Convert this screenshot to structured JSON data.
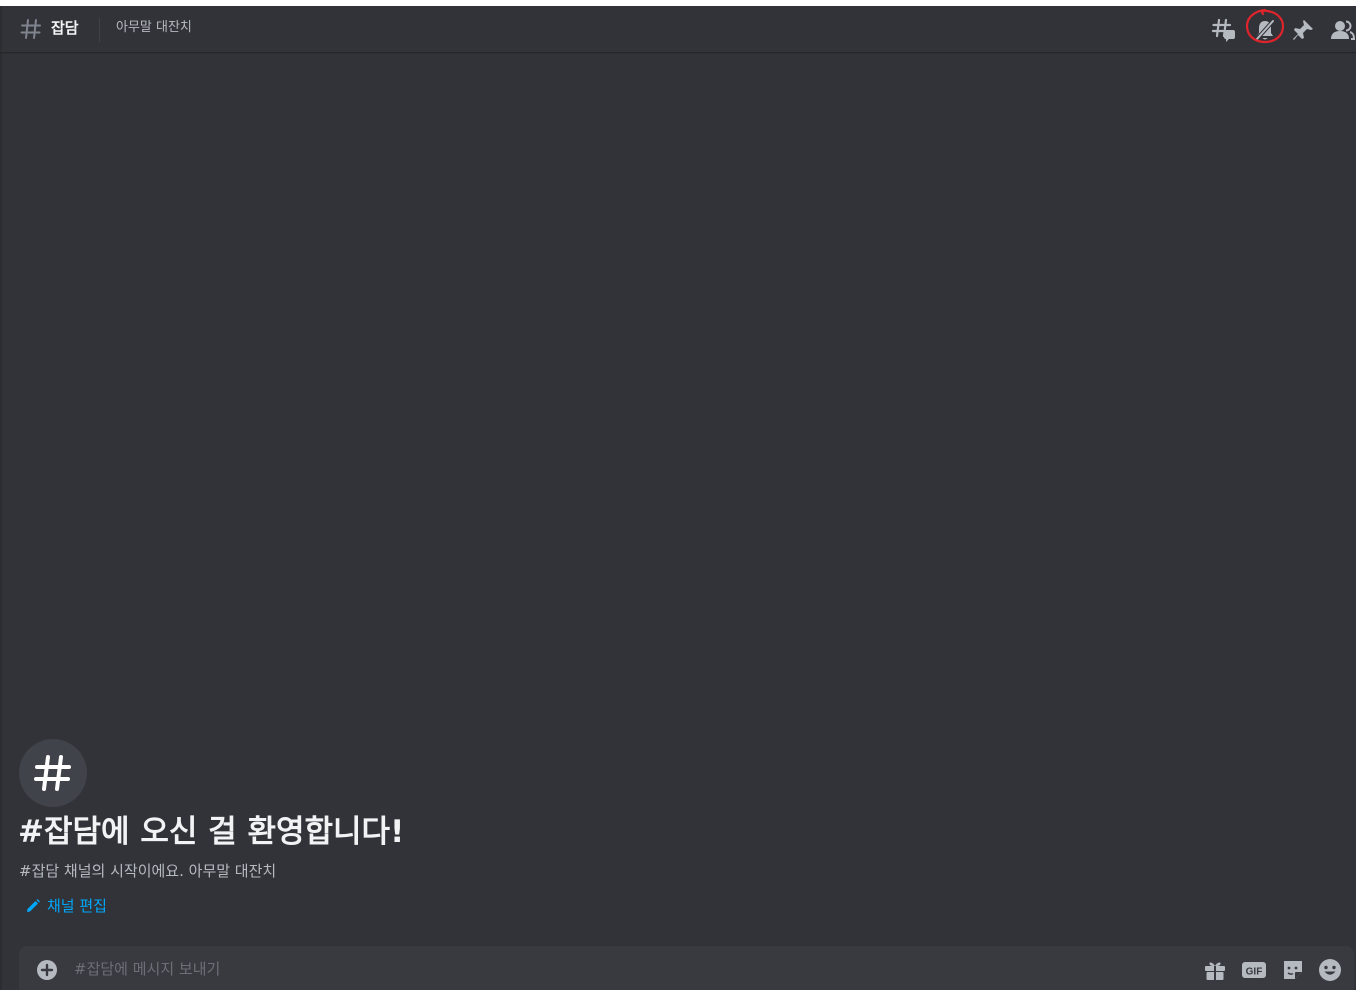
{
  "header": {
    "channel_name": "잡담",
    "topic": "아무말 대잔치",
    "icons": [
      "threads-icon",
      "notification-muted-icon",
      "pin-icon",
      "member-list-icon"
    ]
  },
  "welcome": {
    "title": "#잡담에 오신 걸 환영합니다!",
    "description": "#잡담 채널의 시작이에요. 아무말 대잔치",
    "edit_channel_label": "채널 편집"
  },
  "composer": {
    "placeholder": "#잡담에 메시지 보내기",
    "icons": [
      "add-attachment-icon",
      "gift-icon",
      "gif-icon",
      "sticker-icon",
      "emoji-icon"
    ],
    "gif_label": "GIF"
  },
  "colors": {
    "background": "#313338",
    "header_text": "#f2f3f5",
    "muted_text": "#b5bac1",
    "link": "#00a8fc",
    "annotation": "#e0242b"
  }
}
